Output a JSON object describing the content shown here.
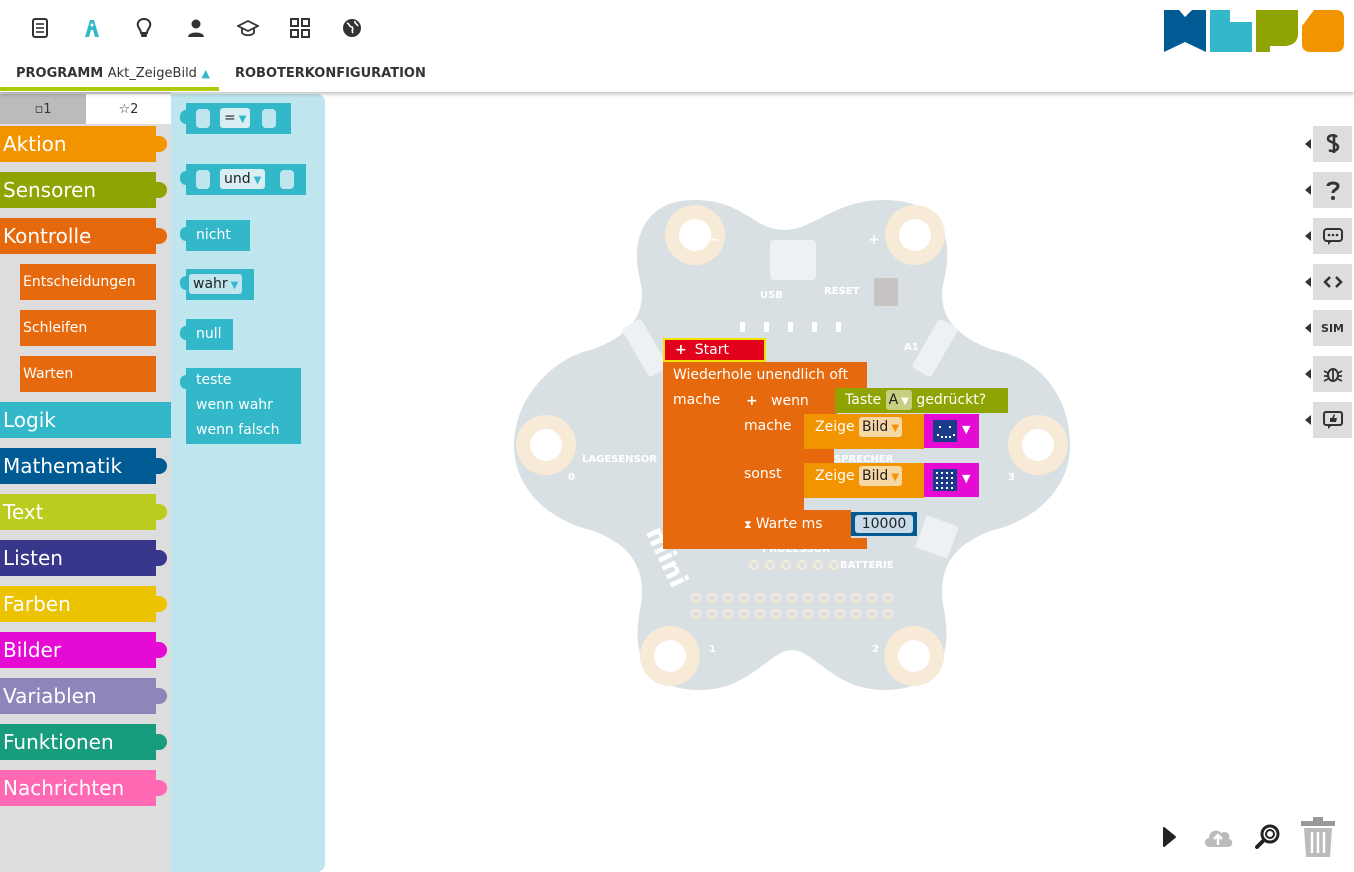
{
  "header": {
    "tabs": {
      "program": {
        "label": "PROGRAMM",
        "name": "Akt_ZeigeBild"
      },
      "robot": {
        "label": "ROBOTERKONFIGURATION"
      }
    }
  },
  "nav_icons": [
    "document-icon",
    "robot-icon",
    "lightbulb-icon",
    "user-icon",
    "graduation-cap-icon",
    "gallery-icon",
    "globe-icon"
  ],
  "logo": {
    "colors": [
      "#005a94",
      "#33b8ca",
      "#8fa402",
      "#f29400"
    ]
  },
  "toolbox": {
    "tabs": [
      {
        "label": "▫1"
      },
      {
        "label": "☆2"
      }
    ],
    "categories": [
      {
        "label": "Aktion",
        "color": "#f29400"
      },
      {
        "label": "Sensoren",
        "color": "#8fa402"
      },
      {
        "label": "Kontrolle",
        "color": "#e7690d"
      },
      {
        "label": "Logik",
        "color": "#33b8ca"
      },
      {
        "label": "Mathematik",
        "color": "#005a94"
      },
      {
        "label": "Text",
        "color": "#bacc1e"
      },
      {
        "label": "Listen",
        "color": "#39378b"
      },
      {
        "label": "Farben",
        "color": "#ebc300"
      },
      {
        "label": "Bilder",
        "color": "#e60ad5"
      },
      {
        "label": "Variablen",
        "color": "#9085ba"
      },
      {
        "label": "Funktionen",
        "color": "#179c7d"
      },
      {
        "label": "Nachrichten",
        "color": "#ff69b4"
      }
    ],
    "subcategories": [
      {
        "label": "Entscheidungen"
      },
      {
        "label": "Schleifen"
      },
      {
        "label": "Warten"
      }
    ]
  },
  "flyout": {
    "compare_op": "=",
    "logic_op": "und",
    "not_label": "nicht",
    "bool_value": "wahr",
    "null_label": "null",
    "ternary": {
      "test": "teste",
      "if_true": "wenn wahr",
      "if_false": "wenn falsch"
    }
  },
  "program": {
    "start": "Start",
    "loop": "Wiederhole unendlich oft",
    "do": "mache",
    "if": "wenn",
    "if_do": "mache",
    "else": "sonst",
    "condition": {
      "prefix": "Taste",
      "button": "A",
      "suffix": "gedrückt?"
    },
    "show1": {
      "label": "Zeige",
      "type": "Bild"
    },
    "show2": {
      "label": "Zeige",
      "type": "Bild"
    },
    "wait": {
      "label": "Warte ms",
      "value": "10000"
    }
  },
  "board": {
    "labels": {
      "usb": "USB",
      "reset": "RESET",
      "a1": "A1",
      "lagesensor": "LAGESENSOR",
      "pin0": "0",
      "pin1": "1",
      "pin2": "2",
      "pin3": "3",
      "sprecher": "SPRECHER",
      "prozessor": "PROZESSOR",
      "batterie": "BATTERIE",
      "minus": "−",
      "plus": "+",
      "brand": "mini"
    }
  },
  "right_tools": [
    {
      "icon": "code-snippet-icon",
      "label": ""
    },
    {
      "icon": "help-icon",
      "label": ""
    },
    {
      "icon": "comment-icon",
      "label": ""
    },
    {
      "icon": "source-code-icon",
      "label": ""
    },
    {
      "icon": "simulation-icon",
      "label": "SIM"
    },
    {
      "icon": "bug-icon",
      "label": ""
    },
    {
      "icon": "like-icon",
      "label": ""
    }
  ],
  "bottom_tools": [
    "run-icon",
    "upload-icon",
    "zoom-icon",
    "trash-icon"
  ]
}
